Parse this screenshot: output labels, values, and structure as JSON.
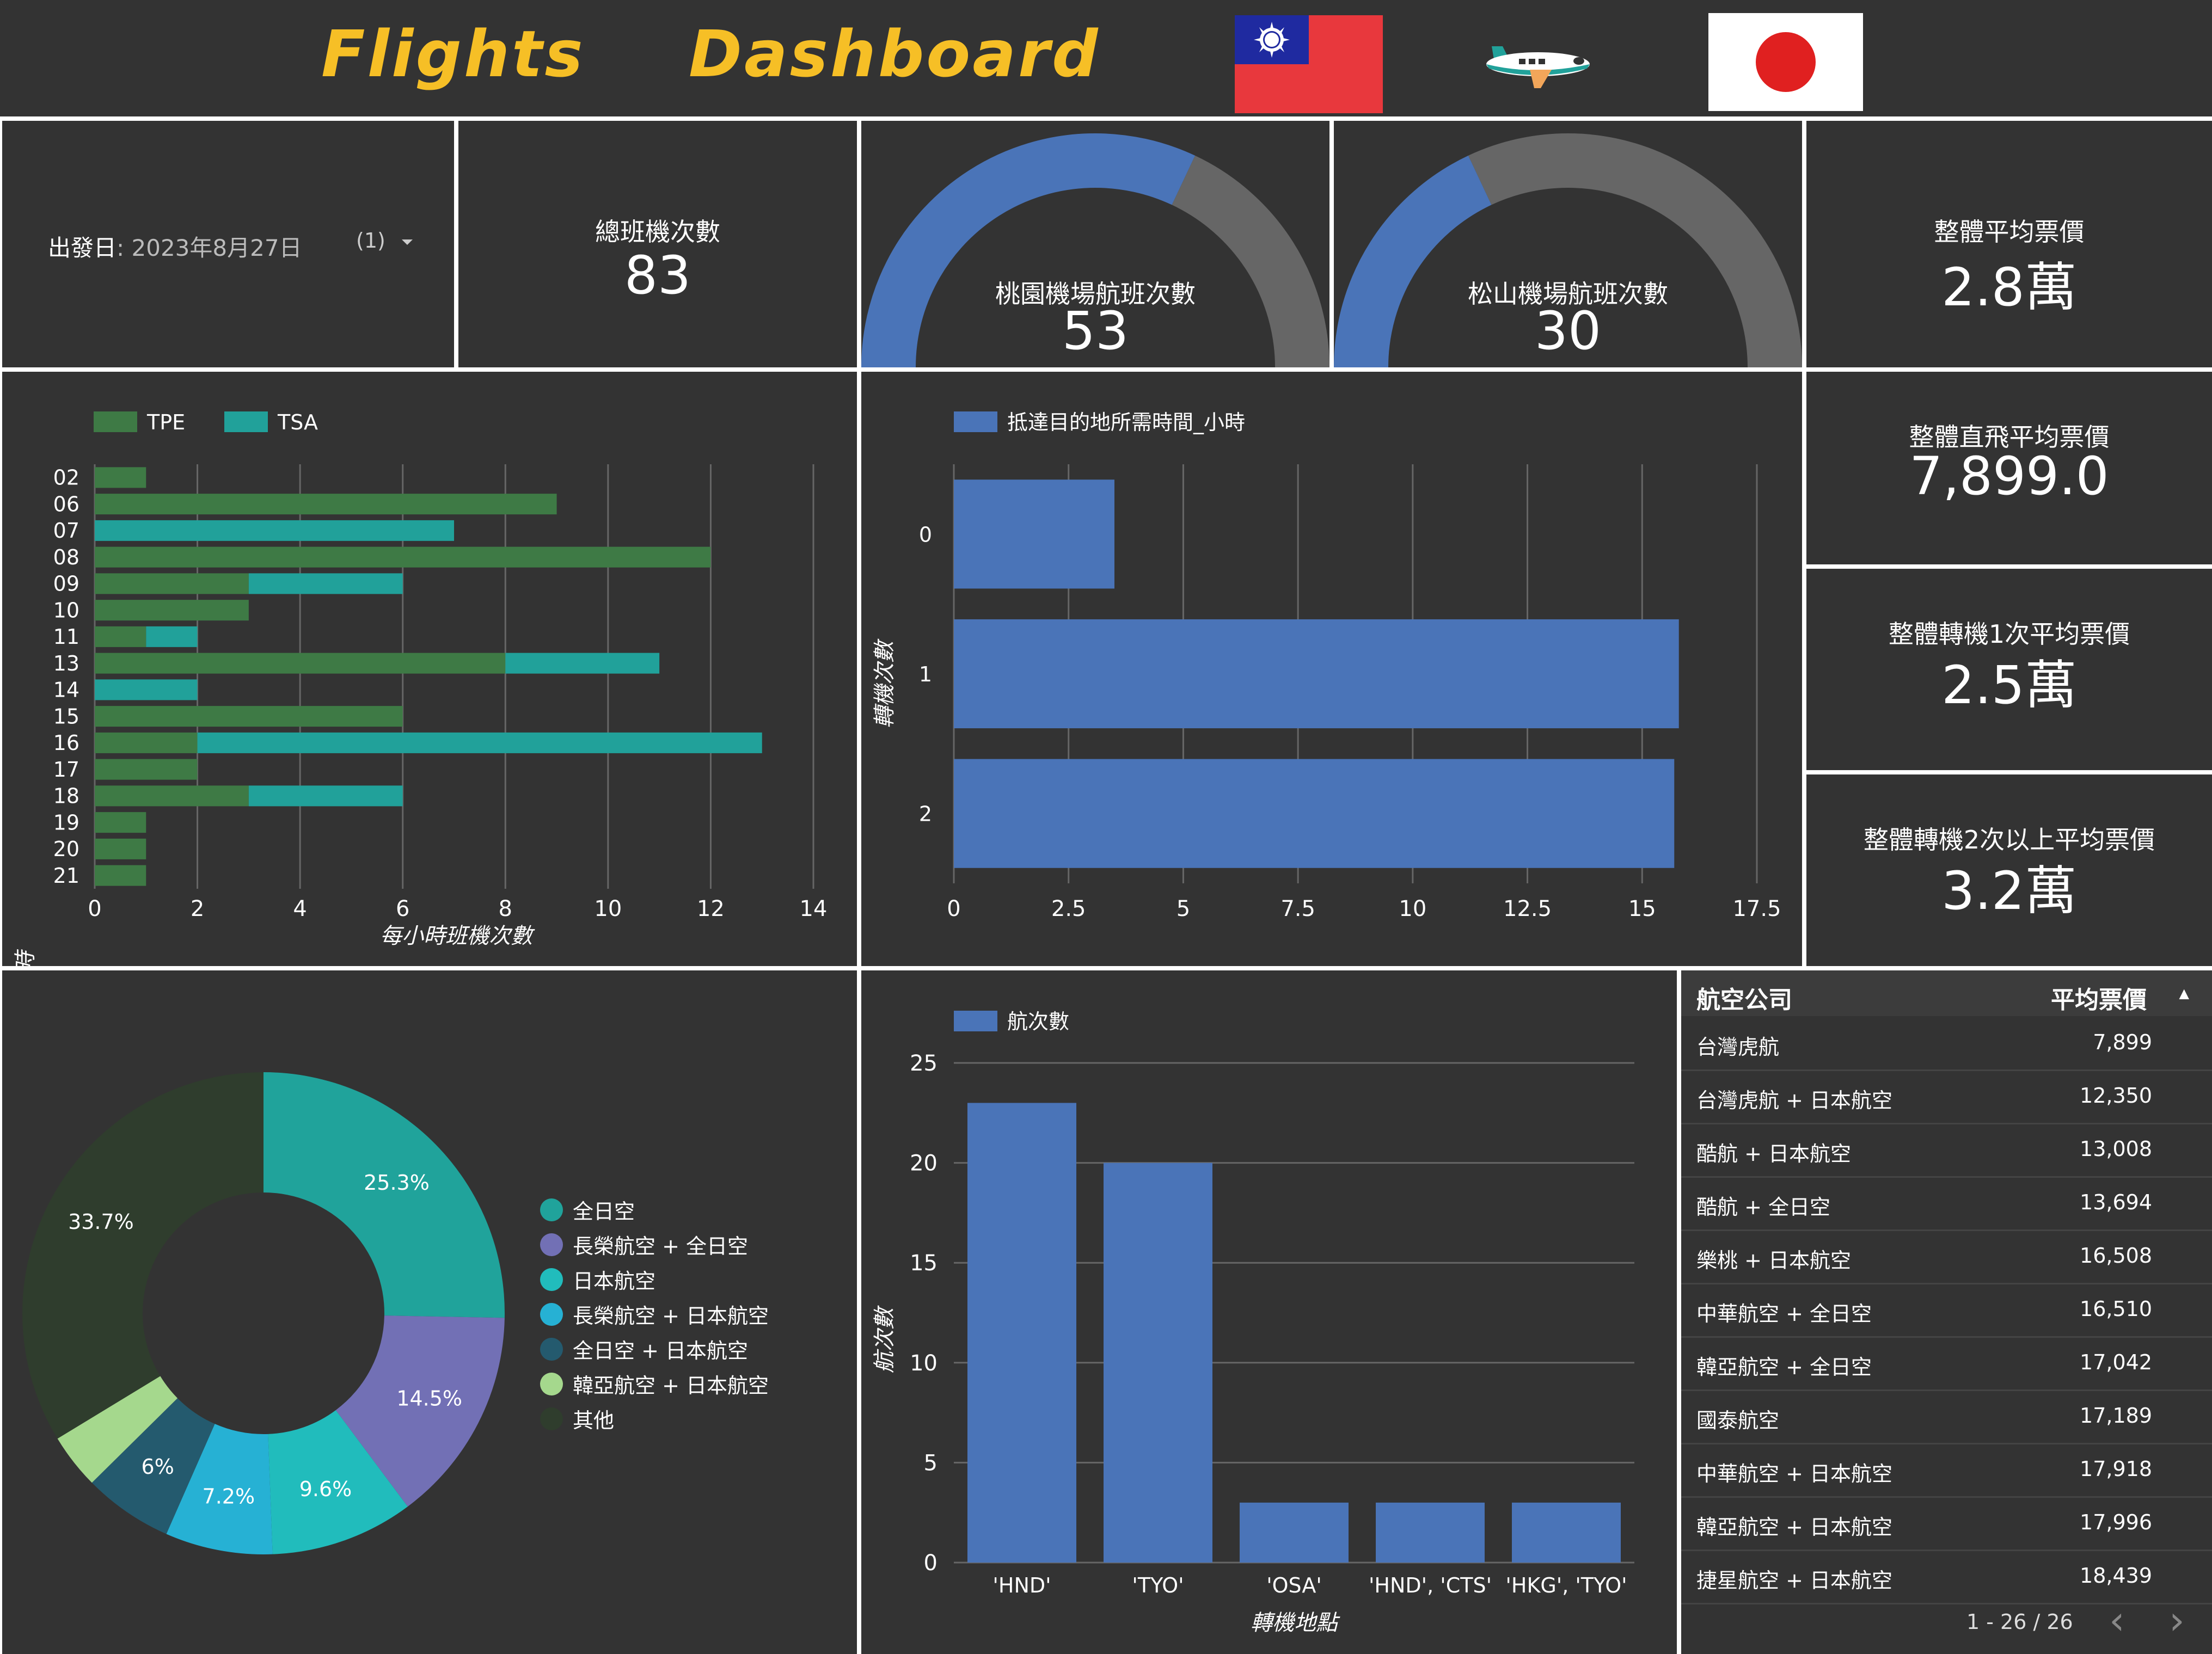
{
  "header": {
    "title_word1": "Flights",
    "title_word2": "Dashboard"
  },
  "filter": {
    "label": "出發日",
    "value": ": 2023年8月27日",
    "count": "(1)"
  },
  "kpis": {
    "total_flights": {
      "label": "總班機次數",
      "value": "83"
    },
    "tpe_flights": {
      "label": "桃園機場航班次數",
      "value": "53",
      "fraction": 0.64
    },
    "tsa_flights": {
      "label": "松山機場航班次數",
      "value": "30",
      "fraction": 0.36
    },
    "avg_price": {
      "label": "整體平均票價",
      "value": "2.8萬"
    },
    "direct_avg": {
      "label": "整體直飛平均票價",
      "value": "7,899.0"
    },
    "one_stop_avg": {
      "label": "整體轉機1次平均票價",
      "value": "2.5萬"
    },
    "two_stop_avg": {
      "label": "整體轉機2次以上平均票價",
      "value": "3.2萬"
    }
  },
  "colors": {
    "panel": "#333333",
    "tpe": "#3e7a45",
    "tsa": "#21a19a",
    "blue": "#4a74b8",
    "gauge_rest": "#666666",
    "title": "#f6bf26"
  },
  "charts": [
    {
      "type": "bar",
      "orientation": "horizontal",
      "stacked": true,
      "categories": [
        "02",
        "06",
        "07",
        "08",
        "09",
        "10",
        "11",
        "13",
        "14",
        "15",
        "16",
        "17",
        "18",
        "19",
        "20",
        "21"
      ],
      "series": [
        {
          "name": "TPE",
          "values": [
            1,
            9,
            0,
            12,
            3,
            3,
            1,
            8,
            0,
            6,
            2,
            2,
            3,
            1,
            1,
            1
          ]
        },
        {
          "name": "TSA",
          "values": [
            0,
            0,
            7,
            0,
            3,
            0,
            1,
            3,
            2,
            0,
            11,
            0,
            3,
            0,
            0,
            0
          ]
        }
      ],
      "xlabel": "每小時班機次數",
      "ylabel": "出發日_時",
      "xlim": [
        0,
        14
      ],
      "xticks": [
        "0",
        "2",
        "4",
        "6",
        "8",
        "10",
        "12",
        "14"
      ],
      "legend": "top-left",
      "grid": true
    },
    {
      "type": "bar",
      "orientation": "horizontal",
      "categories": [
        "0",
        "1",
        "2"
      ],
      "series": [
        {
          "name": "抵達目的地所需時間_小時",
          "values": [
            3.5,
            15.8,
            15.7
          ]
        }
      ],
      "ylabel": "轉機次數",
      "xlim": [
        0,
        17.5
      ],
      "xticks": [
        "0",
        "2.5",
        "5",
        "7.5",
        "10",
        "12.5",
        "15",
        "17.5"
      ],
      "legend": "top-left",
      "grid": true
    },
    {
      "type": "pie",
      "donut": true,
      "slices": [
        {
          "label": "全日空",
          "value": 25.3,
          "pct": "25.3%",
          "color": "#20a39b"
        },
        {
          "label": "長榮航空 + 全日空",
          "value": 14.5,
          "pct": "14.5%",
          "color": "#7270b5"
        },
        {
          "label": "日本航空",
          "value": 9.6,
          "pct": "9.6%",
          "color": "#21bcbc"
        },
        {
          "label": "長榮航空 + 日本航空",
          "value": 7.2,
          "pct": "7.2%",
          "color": "#26b1d4"
        },
        {
          "label": "全日空 + 日本航空",
          "value": 6,
          "pct": "6%",
          "color": "#245a6e"
        },
        {
          "label": "韓亞航空 + 日本航空",
          "value": 3.7,
          "pct": "",
          "color": "#a5d88d"
        },
        {
          "label": "其他",
          "value": 33.7,
          "pct": "33.7%",
          "color": "#2f3d2d"
        }
      ],
      "legend": "right"
    },
    {
      "type": "bar",
      "orientation": "vertical",
      "categories": [
        "'HND'",
        "'TYO'",
        "'OSA'",
        "'HND', 'CTS'",
        "'HKG', 'TYO'"
      ],
      "series": [
        {
          "name": "航次數",
          "values": [
            23,
            20,
            3,
            3,
            3
          ]
        }
      ],
      "xlabel": "轉機地點",
      "ylabel": "航次數",
      "ylim": [
        0,
        25
      ],
      "yticks": [
        "0",
        "5",
        "10",
        "15",
        "20",
        "25"
      ],
      "legend": "top-left",
      "grid": true
    }
  ],
  "table": {
    "col1": "航空公司",
    "col2": "平均票價",
    "sort_icon": "▲",
    "rows": [
      {
        "airline": "台灣虎航",
        "price": "7,899"
      },
      {
        "airline": "台灣虎航 + 日本航空",
        "price": "12,350"
      },
      {
        "airline": "酷航 + 日本航空",
        "price": "13,008"
      },
      {
        "airline": "酷航 + 全日空",
        "price": "13,694"
      },
      {
        "airline": "樂桃 + 日本航空",
        "price": "16,508"
      },
      {
        "airline": "中華航空 + 全日空",
        "price": "16,510"
      },
      {
        "airline": "韓亞航空 + 全日空",
        "price": "17,042"
      },
      {
        "airline": "國泰航空",
        "price": "17,189"
      },
      {
        "airline": "中華航空 + 日本航空",
        "price": "17,918"
      },
      {
        "airline": "韓亞航空 + 日本航空",
        "price": "17,996"
      },
      {
        "airline": "捷星航空 + 日本航空",
        "price": "18,439"
      }
    ],
    "pagination": "1 - 26 / 26",
    "prev_icon": "‹",
    "next_icon": "›"
  }
}
